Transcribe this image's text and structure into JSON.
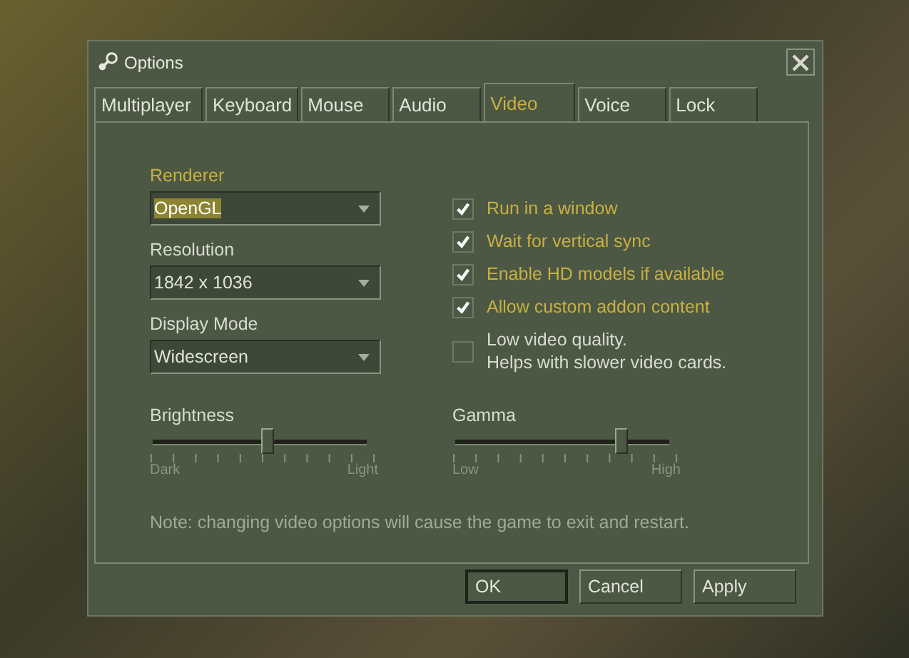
{
  "window": {
    "title": "Options"
  },
  "tabs": [
    {
      "label": "Multiplayer",
      "selected": false
    },
    {
      "label": "Keyboard",
      "selected": false
    },
    {
      "label": "Mouse",
      "selected": false
    },
    {
      "label": "Audio",
      "selected": false
    },
    {
      "label": "Video",
      "selected": true
    },
    {
      "label": "Voice",
      "selected": false
    },
    {
      "label": "Lock",
      "selected": false
    }
  ],
  "dropdowns": [
    {
      "label": "Renderer",
      "value": "OpenGL",
      "focused": true
    },
    {
      "label": "Resolution",
      "value": "1842 x 1036",
      "focused": false
    },
    {
      "label": "Display Mode",
      "value": "Widescreen",
      "focused": false
    }
  ],
  "checkboxes": [
    {
      "label": "Run in a window",
      "checked": true
    },
    {
      "label": "Wait for vertical sync",
      "checked": true
    },
    {
      "label": "Enable HD models if available",
      "checked": true
    },
    {
      "label": "Allow custom addon content",
      "checked": true
    },
    {
      "label": "Low video quality.\nHelps with slower video cards.",
      "checked": false
    }
  ],
  "sliders": [
    {
      "label": "Brightness",
      "level": 0.53,
      "min_label": "Dark",
      "max_label": "Light"
    },
    {
      "label": "Gamma",
      "level": 0.77,
      "min_label": "Low",
      "max_label": "High"
    }
  ],
  "note": "Note: changing video options will cause the game to exit and restart.",
  "buttons": [
    {
      "label": "OK",
      "default": true
    },
    {
      "label": "Cancel",
      "default": false
    },
    {
      "label": "Apply",
      "default": false
    }
  ]
}
